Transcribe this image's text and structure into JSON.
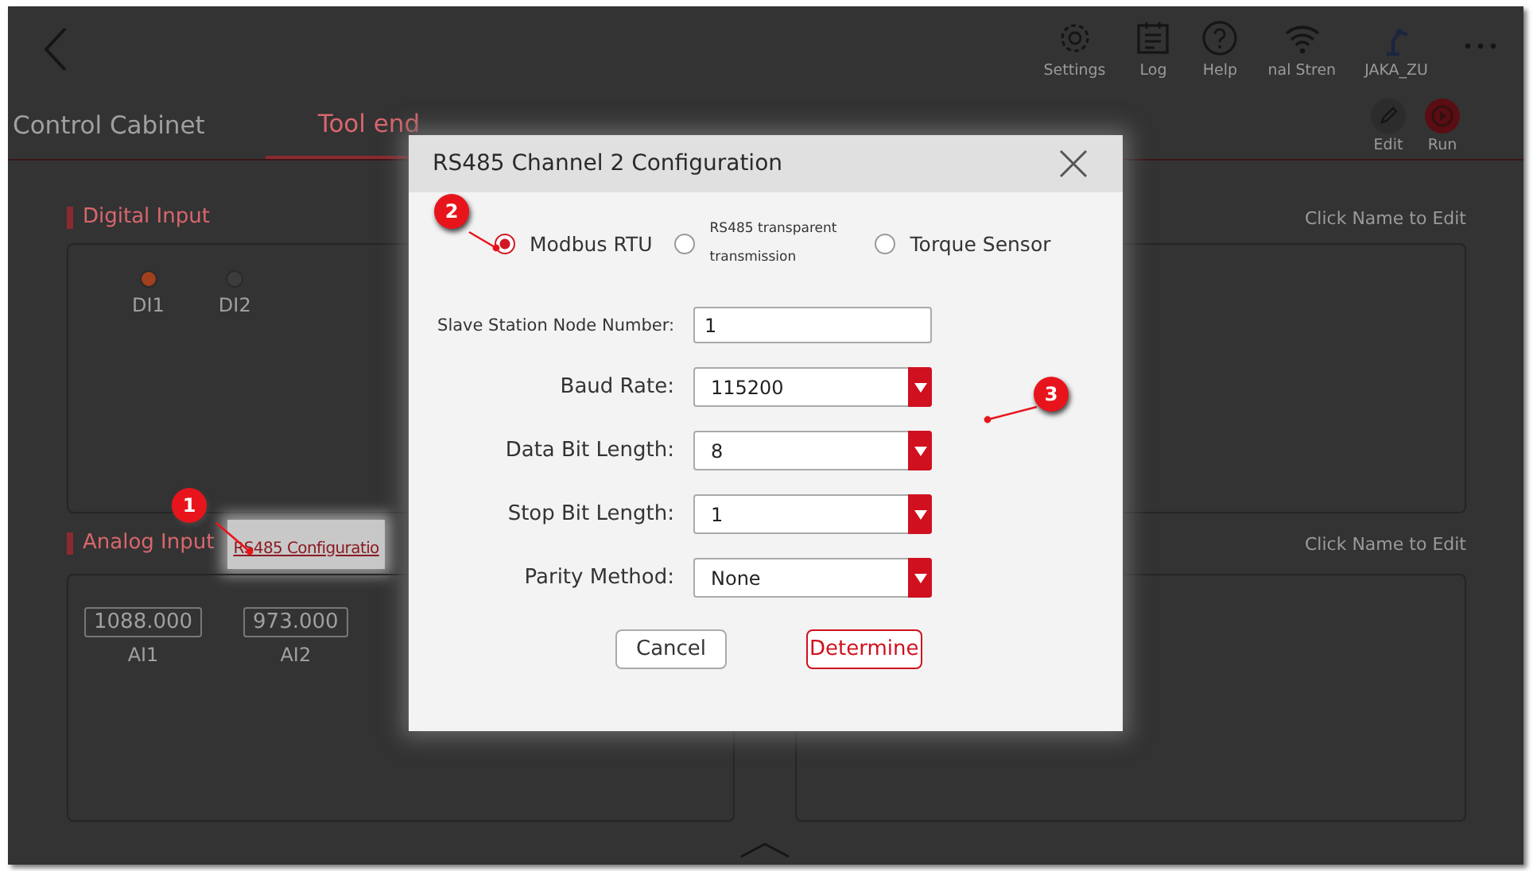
{
  "top_bar": {
    "items": [
      {
        "label": "Settings",
        "kind": "gear"
      },
      {
        "label": "Log",
        "kind": "log"
      },
      {
        "label": "Help",
        "kind": "help"
      },
      {
        "label": "nal Stren",
        "kind": "wifi"
      },
      {
        "label": "JAKA_ZU",
        "kind": "robot"
      }
    ]
  },
  "tabs": [
    {
      "label": "Control Cabinet",
      "selected": false
    },
    {
      "label": "Tool end",
      "selected": true
    }
  ],
  "toolbar": [
    {
      "label": "Edit",
      "kind": "edit"
    },
    {
      "label": "Run",
      "kind": "run"
    }
  ],
  "digital_input": {
    "title": "Digital Input",
    "hint": "Click Name to Edit",
    "items": [
      {
        "label": "DI1",
        "on": true
      },
      {
        "label": "DI2",
        "on": false
      }
    ]
  },
  "analog_input": {
    "title": "Analog Input",
    "link": "RS485 Configuratio",
    "hint": "Click Name to Edit",
    "items": [
      {
        "label": "AI1",
        "value": "1088.000"
      },
      {
        "label": "AI2",
        "value": "973.000"
      }
    ]
  },
  "dialog": {
    "title": "RS485 Channel 2 Configuration",
    "modes": [
      {
        "label": "Modbus RTU",
        "selected": true
      },
      {
        "label": "RS485 transparent transmission",
        "selected": false
      },
      {
        "label": "Torque Sensor",
        "selected": false
      }
    ],
    "fields": [
      {
        "label": "Slave Station Node Number:",
        "value": "1",
        "kind": "text"
      },
      {
        "label": "Baud Rate:",
        "value": "115200",
        "kind": "select"
      },
      {
        "label": "Data Bit Length:",
        "value": "8",
        "kind": "select"
      },
      {
        "label": "Stop Bit Length:",
        "value": "1",
        "kind": "select"
      },
      {
        "label": "Parity Method:",
        "value": "None",
        "kind": "select"
      }
    ],
    "buttons": [
      {
        "label": "Cancel",
        "kind": "secondary"
      },
      {
        "label": "Determine",
        "kind": "primary"
      }
    ]
  },
  "callouts": [
    {
      "number": "1"
    },
    {
      "number": "2"
    },
    {
      "number": "3"
    }
  ]
}
